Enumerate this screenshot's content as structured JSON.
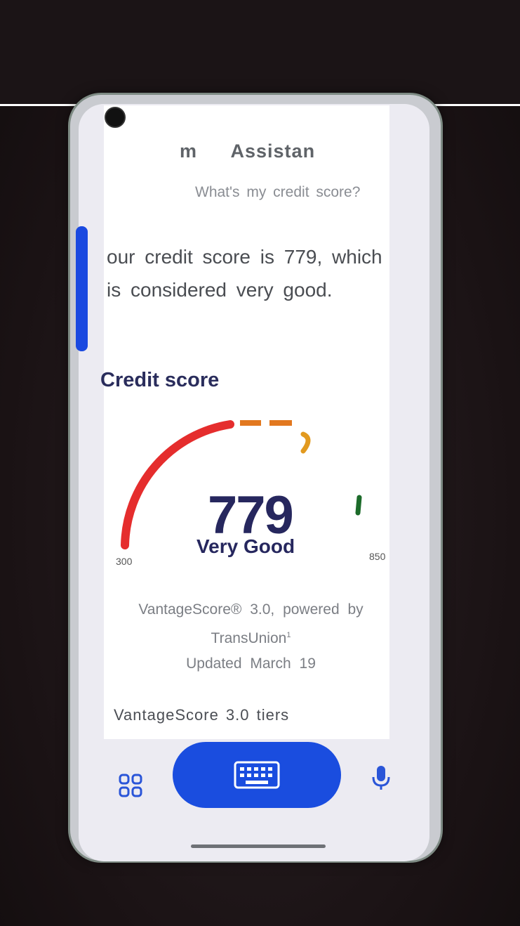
{
  "assistant": {
    "title": "m     Assistan",
    "query": "What's my credit score?",
    "answer": "our credit score is 779, which is considered very good."
  },
  "credit_card": {
    "heading": "Credit score",
    "score": "779",
    "tier": "Very Good",
    "range_min": "300",
    "range_max": "850",
    "score_fraction": 0.87,
    "source_line1": "VantageScore® 3.0, powered by",
    "source_line2": "TransUnion",
    "source_footnote": "1",
    "updated": "Updated March 19",
    "tiers_link": "VantageScore 3.0 tiers"
  },
  "bottom_bar": {
    "apps_icon": "grid-icon",
    "keyboard_icon": "keyboard-icon",
    "mic_icon": "mic-icon"
  },
  "colors": {
    "accent_blue": "#1a4ddf",
    "gauge_red": "#e52d2d",
    "gauge_orange": "#e2781f",
    "gauge_green": "#1c6b2a",
    "score_navy": "#26275e"
  }
}
